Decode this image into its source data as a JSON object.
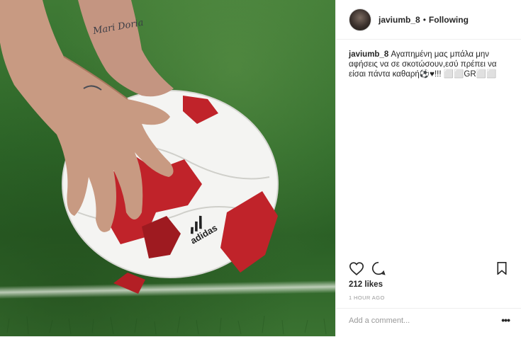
{
  "header": {
    "username": "javiumb_8",
    "separator": "•",
    "follow_status": "Following"
  },
  "caption": {
    "username": "javiumb_8",
    "text": "Αγαπημένη μας μπάλα μην αφήσεις να σε σκοτώσουν,εσύ πρέπει να είσαι πάντα καθαρή⚽♥!!! ⬜⬜GR⬜⬜"
  },
  "image": {
    "tattoo_text": "Mari Doria",
    "ball_brand": "adidas"
  },
  "icons": {
    "like": "heart-icon",
    "comment": "comment-icon",
    "save": "bookmark-icon",
    "more": "more-options-icon"
  },
  "stats": {
    "likes": "212 likes",
    "timestamp": "1 HOUR AGO"
  },
  "comment_box": {
    "placeholder": "Add a comment...",
    "more_label": "•••"
  },
  "colors": {
    "ball_red": "#c0232a",
    "grass": "#3a7231",
    "text": "#262626",
    "muted": "#999999"
  }
}
